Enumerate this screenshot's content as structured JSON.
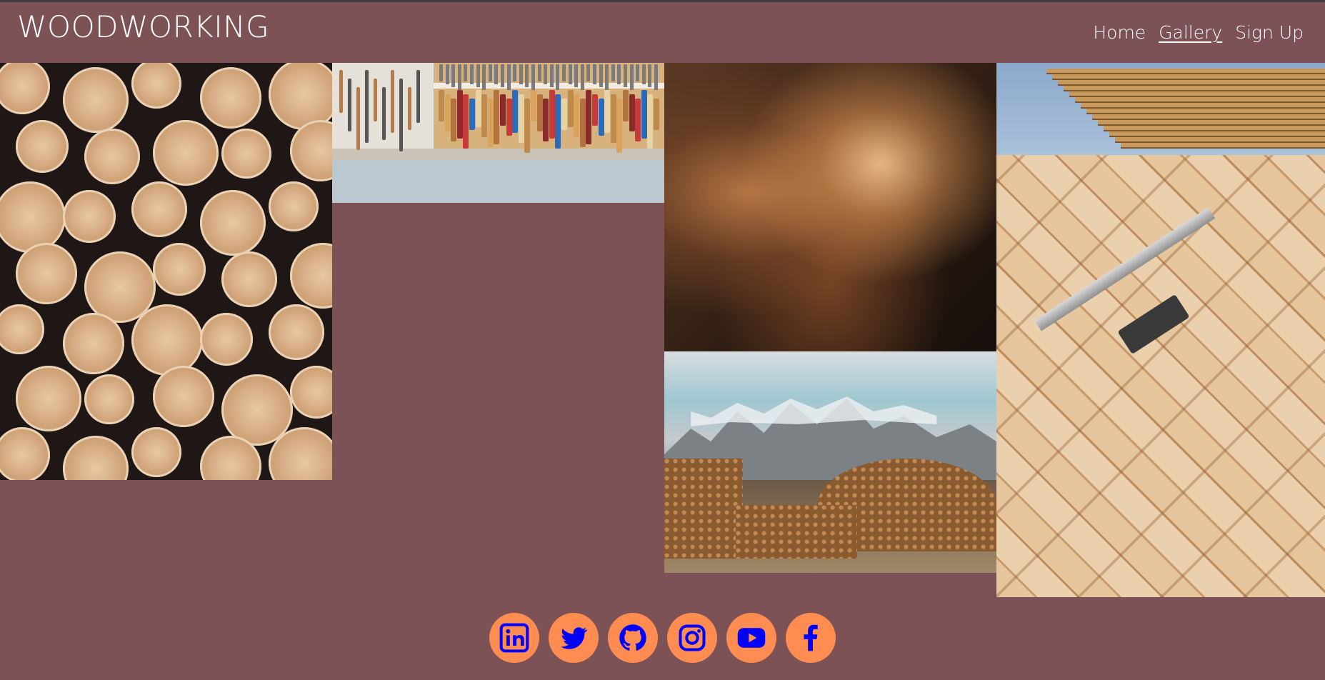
{
  "header": {
    "brand": "WOODWORKING",
    "nav": [
      {
        "label": "Home",
        "active": false
      },
      {
        "label": "Gallery",
        "active": true
      },
      {
        "label": "Sign Up",
        "active": false
      }
    ]
  },
  "gallery": {
    "images": [
      {
        "name": "log-ends-image"
      },
      {
        "name": "tool-wall-image"
      },
      {
        "name": "wood-shavings-image"
      },
      {
        "name": "wooden-structure-image"
      },
      {
        "name": "herringbone-floor-image"
      },
      {
        "name": "mountain-logs-image"
      }
    ]
  },
  "footer": {
    "social": [
      {
        "icon": "linkedin-icon"
      },
      {
        "icon": "twitter-icon"
      },
      {
        "icon": "github-icon"
      },
      {
        "icon": "instagram-icon"
      },
      {
        "icon": "youtube-icon"
      },
      {
        "icon": "facebook-icon"
      }
    ]
  },
  "colors": {
    "background": "#7c5257",
    "icon_circle": "#ff8c50",
    "icon_glyph": "#0000ff",
    "text": "#ffffff"
  }
}
